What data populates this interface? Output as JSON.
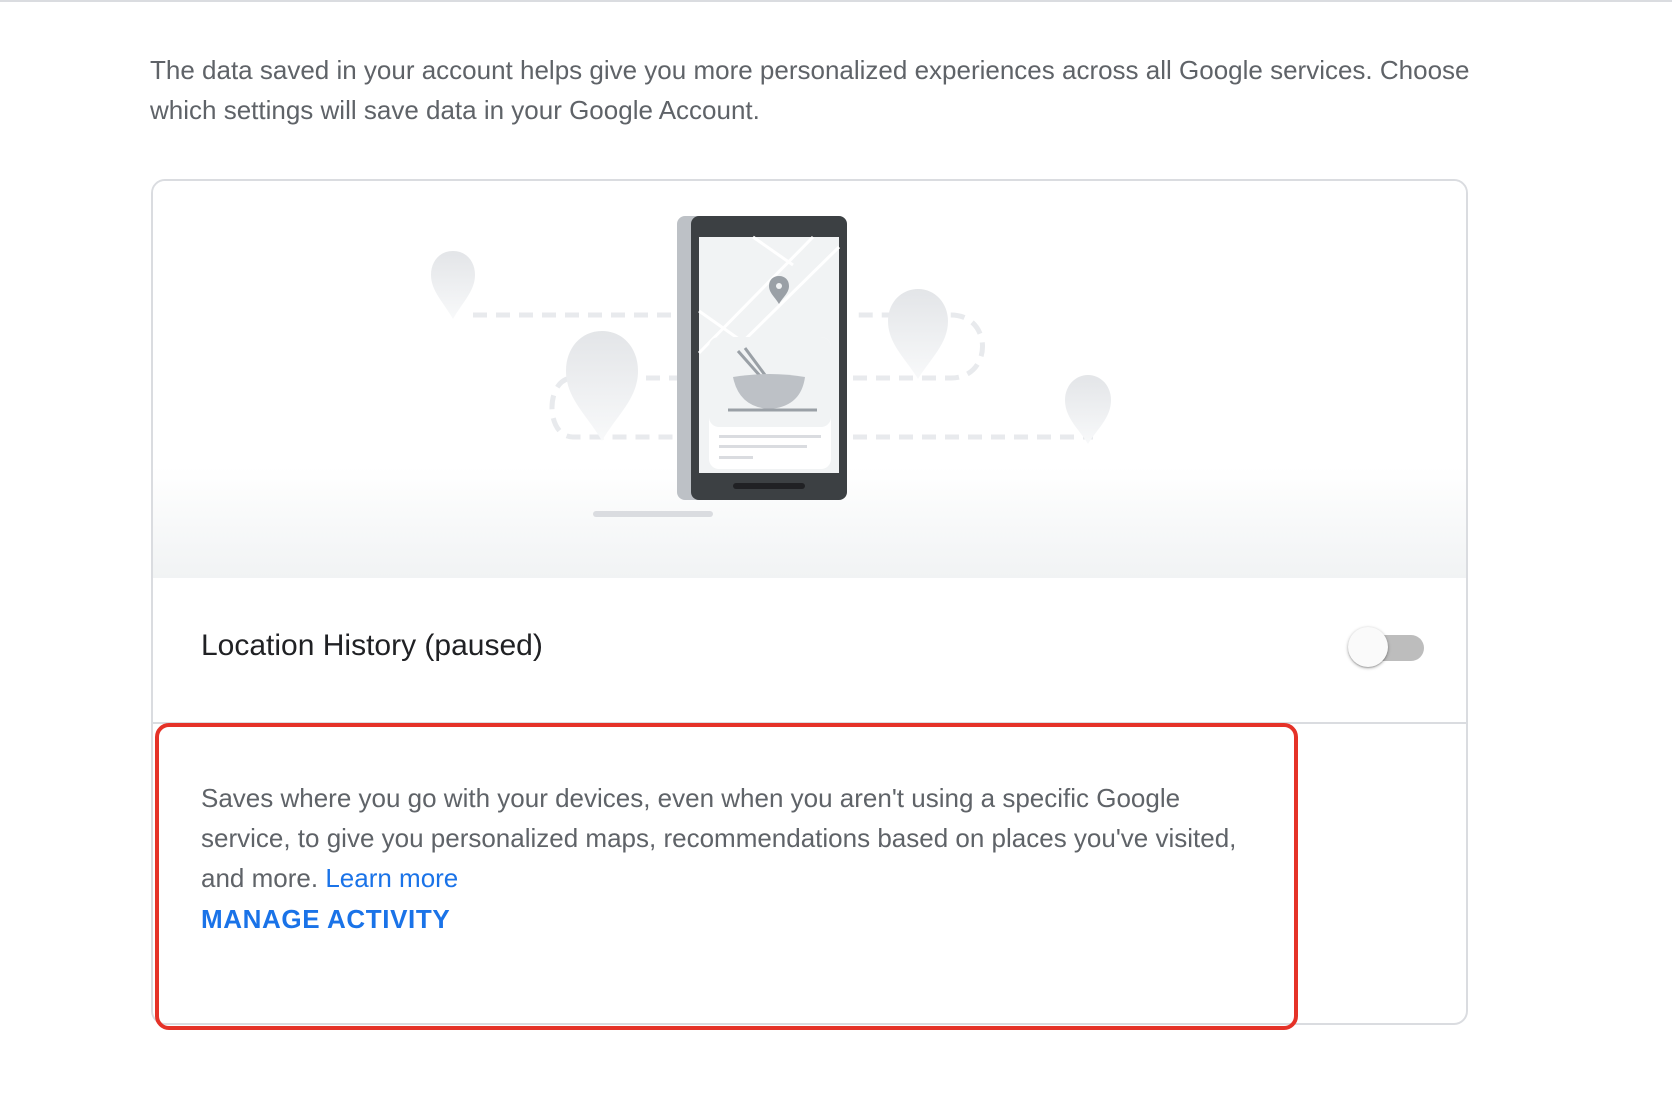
{
  "intro": {
    "text": "The data saved in your account helps give you more personalized experiences across all Google services. Choose which settings will save data in your Google Account."
  },
  "setting": {
    "title": "Location History (paused)",
    "toggle_state": "off",
    "description": "Saves where you go with your devices, even when you aren't using a specific Google service, to give you personalized maps, recommendations based on places you've visited, and more.",
    "learn_more": "Learn more",
    "manage_activity": "MANAGE ACTIVITY"
  },
  "illustration": {
    "subject": "phone-with-map-and-location-pins"
  },
  "colors": {
    "link": "#1a73e8",
    "highlight_border": "#e53228",
    "toggle_track_off": "#bdbdbd",
    "card_border": "#dadce0"
  }
}
